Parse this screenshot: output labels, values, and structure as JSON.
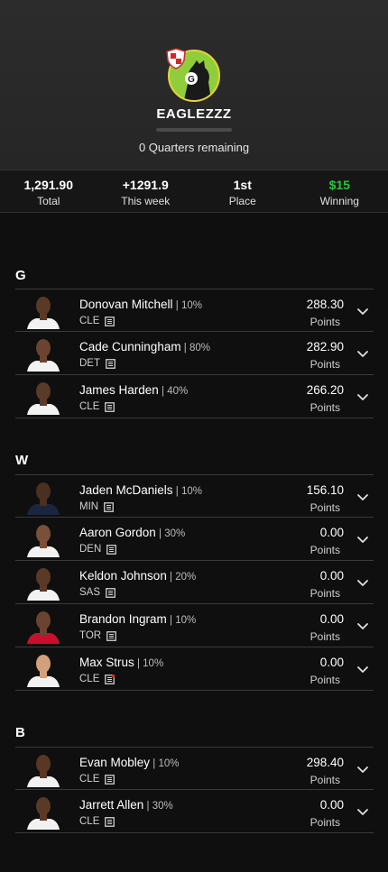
{
  "team": {
    "name": "EAGLEZZZ",
    "quarters_remaining": "0 Quarters remaining",
    "avatar_letter": "G"
  },
  "stats": [
    {
      "value": "1,291.90",
      "label": "Total"
    },
    {
      "value": "+1291.9",
      "label": "This week"
    },
    {
      "value": "1st",
      "label": "Place"
    },
    {
      "value": "$15",
      "label": "Winning",
      "color": "#2fc23c"
    }
  ],
  "sections": [
    {
      "label": "G",
      "players": [
        {
          "name": "Donovan Mitchell",
          "pct": "10%",
          "team": "CLE",
          "points": "288.30",
          "points_label": "Points",
          "jersey": "#f2f2f2",
          "skin": "#5a3a26"
        },
        {
          "name": "Cade Cunningham",
          "pct": "80%",
          "team": "DET",
          "points": "282.90",
          "points_label": "Points",
          "jersey": "#f2f2f2",
          "skin": "#6a4430"
        },
        {
          "name": "James Harden",
          "pct": "40%",
          "team": "CLE",
          "points": "266.20",
          "points_label": "Points",
          "jersey": "#f2f2f2",
          "skin": "#5a3a28"
        }
      ]
    },
    {
      "label": "W",
      "players": [
        {
          "name": "Jaden McDaniels",
          "pct": "10%",
          "team": "MIN",
          "points": "156.10",
          "points_label": "Points",
          "jersey": "#1a2540",
          "skin": "#4a3020"
        },
        {
          "name": "Aaron Gordon",
          "pct": "30%",
          "team": "DEN",
          "points": "0.00",
          "points_label": "Points",
          "jersey": "#f2f2f2",
          "skin": "#7a5038"
        },
        {
          "name": "Keldon Johnson",
          "pct": "20%",
          "team": "SAS",
          "points": "0.00",
          "points_label": "Points",
          "jersey": "#f2f2f2",
          "skin": "#5a3a26"
        },
        {
          "name": "Brandon Ingram",
          "pct": "10%",
          "team": "TOR",
          "points": "0.00",
          "points_label": "Points",
          "jersey": "#c8102e",
          "skin": "#6a4430"
        },
        {
          "name": "Max Strus",
          "pct": "10%",
          "team": "CLE",
          "points": "0.00",
          "points_label": "Points",
          "jersey": "#f2f2f2",
          "skin": "#d2a07a",
          "news_alert": true
        }
      ]
    },
    {
      "label": "B",
      "players": [
        {
          "name": "Evan Mobley",
          "pct": "10%",
          "team": "CLE",
          "points": "298.40",
          "points_label": "Points",
          "jersey": "#f2f2f2",
          "skin": "#5a3624"
        },
        {
          "name": "Jarrett Allen",
          "pct": "30%",
          "team": "CLE",
          "points": "0.00",
          "points_label": "Points",
          "jersey": "#f2f2f2",
          "skin": "#5a3a26"
        }
      ]
    }
  ],
  "icons": {
    "news": "news-icon",
    "expand": "chevron-down-icon",
    "alert_color": "#e0302a"
  }
}
